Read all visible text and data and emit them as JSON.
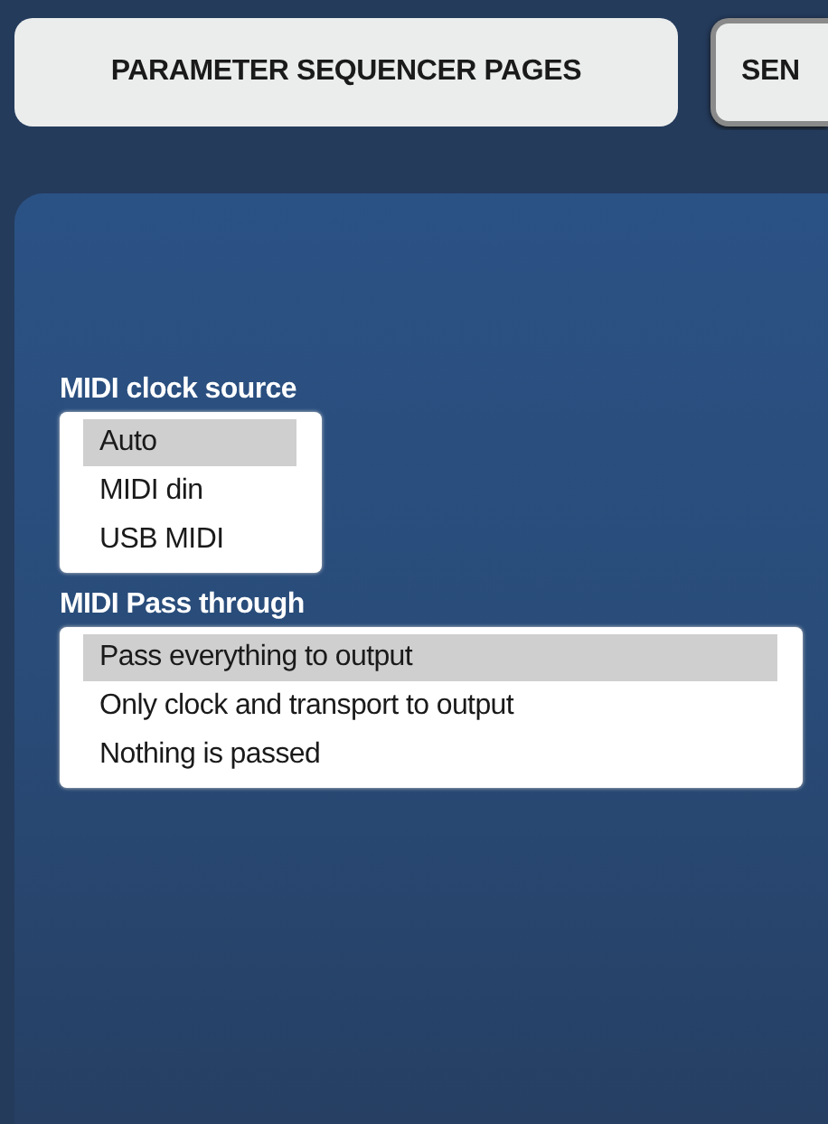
{
  "tabs": [
    {
      "label": "PARAMETER SEQUENCER PAGES"
    },
    {
      "label": "SEN"
    }
  ],
  "groups": [
    {
      "label": "MIDI clock source",
      "options": [
        {
          "label": "Auto",
          "selected": true
        },
        {
          "label": "MIDI din",
          "selected": false
        },
        {
          "label": "USB MIDI",
          "selected": false
        }
      ]
    },
    {
      "label": "MIDI Pass through",
      "options": [
        {
          "label": "Pass everything to output",
          "selected": true
        },
        {
          "label": "Only clock and transport to output",
          "selected": false
        },
        {
          "label": "Nothing is passed",
          "selected": false
        }
      ]
    }
  ]
}
